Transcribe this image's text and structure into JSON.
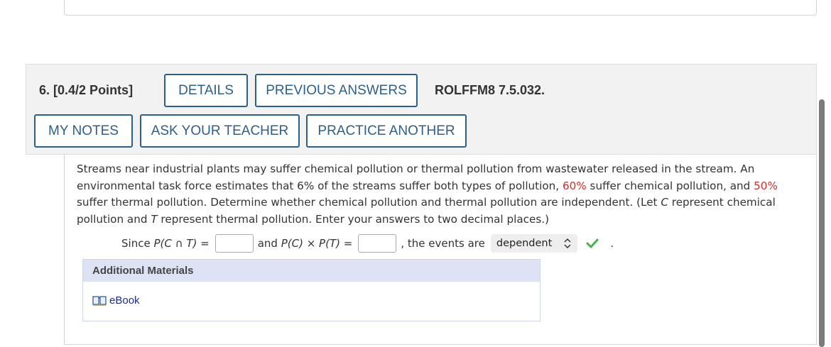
{
  "question": {
    "number": "6.",
    "points": "[0.4/2 Points]",
    "code": "ROLFFM8 7.5.032."
  },
  "buttons": {
    "details": "DETAILS",
    "previous_answers": "PREVIOUS ANSWERS",
    "my_notes": "MY NOTES",
    "ask_teacher": "ASK YOUR TEACHER",
    "practice_another": "PRACTICE ANOTHER"
  },
  "problem": {
    "text_1": "Streams near industrial plants may suffer chemical pollution or thermal pollution from wastewater released in the stream. An environmental task force estimates that 6% of the streams suffer both types of pollution, ",
    "chem_pct": "60%",
    "text_2": " suffer chemical pollution, and ",
    "therm_pct": "50%",
    "text_3": " suffer thermal pollution. Determine whether chemical pollution and thermal pollution are independent. (Let ",
    "var_c": "C",
    "text_4": " represent chemical pollution and ",
    "var_t": "T",
    "text_5": " represent thermal pollution. Enter your answers to two decimal places.)"
  },
  "answer": {
    "since": "Since",
    "expr_1": "P(C ∩ T)",
    "eq_1": "=",
    "and": "and",
    "expr_2": "P(C) × P(T)",
    "eq_2": "=",
    "comma": ",",
    "the_events_are": "the events are",
    "input_1_value": "",
    "input_2_value": "",
    "select_value": "dependent",
    "period": "."
  },
  "additional_materials": {
    "heading": "Additional Materials",
    "ebook_label": "eBook"
  },
  "colors": {
    "button_border": "#2c5f8a",
    "highlight_red": "#c9302c",
    "check_green": "#4caf50",
    "link_blue": "#1a2e8a"
  }
}
